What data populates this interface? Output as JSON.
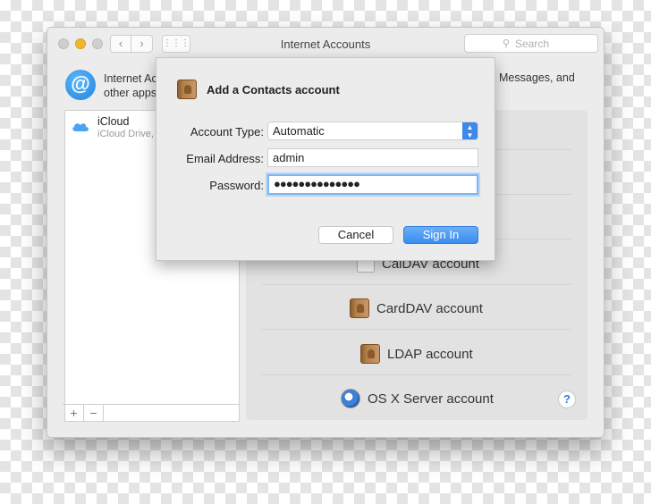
{
  "window": {
    "title": "Internet Accounts",
    "search_placeholder": "Search",
    "nav_back": "‹",
    "nav_forward": "›",
    "grid_glyph": "⋮⋮⋮"
  },
  "description": {
    "line1": "Internet Ac",
    "line2": "other apps",
    "line1_right": "Messages, and"
  },
  "accounts_list": {
    "items": [
      {
        "name": "iCloud",
        "subtitle": "iCloud Drive, ..."
      }
    ],
    "add_label": "+",
    "remove_label": "−"
  },
  "providers": {
    "items": [
      {
        "label": "CalDAV account",
        "icon": "calendar-icon"
      },
      {
        "label": "CardDAV account",
        "icon": "contacts-book-icon"
      },
      {
        "label": "LDAP account",
        "icon": "contacts-book-icon"
      },
      {
        "label": "OS X Server account",
        "icon": "server-icon"
      }
    ],
    "help_label": "?"
  },
  "sheet": {
    "title": "Add a Contacts account",
    "account_type_label": "Account Type:",
    "account_type_value": "Automatic",
    "email_label": "Email Address:",
    "email_value": "admin",
    "password_label": "Password:",
    "password_value": "●●●●●●●●●●●●●●",
    "cancel_label": "Cancel",
    "signin_label": "Sign In"
  },
  "colors": {
    "accent": "#3a8cf0",
    "traffic_yellow": "#f4b52e",
    "window_bg": "#ececec"
  }
}
